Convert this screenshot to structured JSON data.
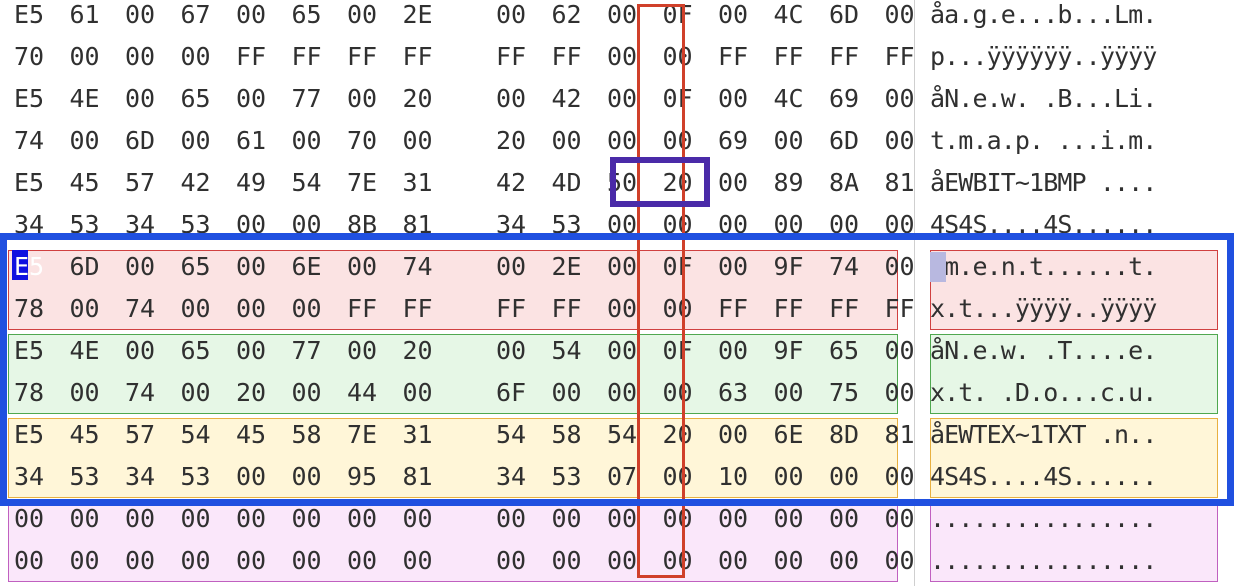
{
  "colors": {
    "entry_red_bg": "#fbe3e3",
    "entry_red_border": "#d04040",
    "entry_green_bg": "#e6f7e6",
    "entry_green_border": "#4fa84f",
    "entry_yellow_bg": "#fff6d8",
    "entry_yellow_border": "#e8b040",
    "entry_pink_bg": "#fae7fa",
    "entry_pink_border": "#c060c0",
    "column_highlight": "#d0402a",
    "attr_highlight": "#4a2aa8",
    "entry_group_highlight": "#2050e0",
    "cursor": "#1010e0"
  },
  "hex_rows": [
    {
      "bytes": [
        "E5",
        "61",
        "00",
        "67",
        "00",
        "65",
        "00",
        "2E",
        "00",
        "62",
        "00",
        "0F",
        "00",
        "4C",
        "6D",
        "00"
      ],
      "ascii": "åa.g.e...b...Lm."
    },
    {
      "bytes": [
        "70",
        "00",
        "00",
        "00",
        "FF",
        "FF",
        "FF",
        "FF",
        "FF",
        "FF",
        "00",
        "00",
        "FF",
        "FF",
        "FF",
        "FF"
      ],
      "ascii": "p...ÿÿÿÿÿÿ..ÿÿÿÿ"
    },
    {
      "bytes": [
        "E5",
        "4E",
        "00",
        "65",
        "00",
        "77",
        "00",
        "20",
        "00",
        "42",
        "00",
        "0F",
        "00",
        "4C",
        "69",
        "00"
      ],
      "ascii": "åN.e.w. .B...Li."
    },
    {
      "bytes": [
        "74",
        "00",
        "6D",
        "00",
        "61",
        "00",
        "70",
        "00",
        "20",
        "00",
        "00",
        "00",
        "69",
        "00",
        "6D",
        "00"
      ],
      "ascii": "t.m.a.p. ...i.m."
    },
    {
      "bytes": [
        "E5",
        "45",
        "57",
        "42",
        "49",
        "54",
        "7E",
        "31",
        "42",
        "4D",
        "50",
        "20",
        "00",
        "89",
        "8A",
        "81"
      ],
      "ascii": "åEWBIT~1BMP ...."
    },
    {
      "bytes": [
        "34",
        "53",
        "34",
        "53",
        "00",
        "00",
        "8B",
        "81",
        "34",
        "53",
        "00",
        "00",
        "00",
        "00",
        "00",
        "00"
      ],
      "ascii": "4S4S....4S......"
    },
    {
      "bytes": [
        "E5",
        "6D",
        "00",
        "65",
        "00",
        "6E",
        "00",
        "74",
        "00",
        "2E",
        "00",
        "0F",
        "00",
        "9F",
        "74",
        "00"
      ],
      "ascii": "åm.e.n.t......t."
    },
    {
      "bytes": [
        "78",
        "00",
        "74",
        "00",
        "00",
        "00",
        "FF",
        "FF",
        "FF",
        "FF",
        "00",
        "00",
        "FF",
        "FF",
        "FF",
        "FF"
      ],
      "ascii": "x.t...ÿÿÿÿ..ÿÿÿÿ"
    },
    {
      "bytes": [
        "E5",
        "4E",
        "00",
        "65",
        "00",
        "77",
        "00",
        "20",
        "00",
        "54",
        "00",
        "0F",
        "00",
        "9F",
        "65",
        "00"
      ],
      "ascii": "åN.e.w. .T....e."
    },
    {
      "bytes": [
        "78",
        "00",
        "74",
        "00",
        "20",
        "00",
        "44",
        "00",
        "6F",
        "00",
        "00",
        "00",
        "63",
        "00",
        "75",
        "00"
      ],
      "ascii": "x.t. .D.o...c.u."
    },
    {
      "bytes": [
        "E5",
        "45",
        "57",
        "54",
        "45",
        "58",
        "7E",
        "31",
        "54",
        "58",
        "54",
        "20",
        "00",
        "6E",
        "8D",
        "81"
      ],
      "ascii": "åEWTEX~1TXT .n.."
    },
    {
      "bytes": [
        "34",
        "53",
        "34",
        "53",
        "00",
        "00",
        "95",
        "81",
        "34",
        "53",
        "07",
        "00",
        "10",
        "00",
        "00",
        "00"
      ],
      "ascii": "4S4S....4S......"
    },
    {
      "bytes": [
        "00",
        "00",
        "00",
        "00",
        "00",
        "00",
        "00",
        "00",
        "00",
        "00",
        "00",
        "00",
        "00",
        "00",
        "00",
        "00"
      ],
      "ascii": "................"
    },
    {
      "bytes": [
        "00",
        "00",
        "00",
        "00",
        "00",
        "00",
        "00",
        "00",
        "00",
        "00",
        "00",
        "00",
        "00",
        "00",
        "00",
        "00"
      ],
      "ascii": "................"
    }
  ]
}
